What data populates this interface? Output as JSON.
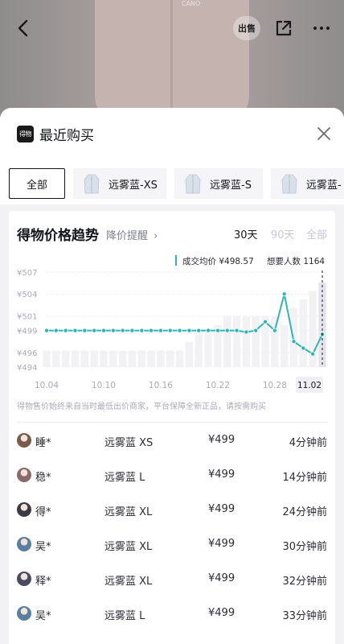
{
  "colors": {
    "teal": "#2fb5b7",
    "text": "#14151a",
    "muted": "#aaaabb",
    "bar": "#f0f0f3"
  },
  "top_bar": {
    "back_icon": "chevron-left-icon",
    "sell_label": "出售",
    "share_icon": "share-icon",
    "more_icon": "more-icon",
    "product_logo_text": "CANO"
  },
  "sheet": {
    "logo_text": "得物",
    "title": "最近购买",
    "close_icon": "close-icon"
  },
  "chips": [
    {
      "label": "全部",
      "active": true
    },
    {
      "label": "远雾蓝-XS",
      "active": false
    },
    {
      "label": "远雾蓝-S",
      "active": false
    },
    {
      "label": "远雾蓝-",
      "active": false
    }
  ],
  "trend": {
    "title": "得物价格趋势",
    "alert_label": "降价提醒",
    "ranges": [
      "30天",
      "90天",
      "全部"
    ],
    "avg_label": "成交均价 ¥498.57",
    "want_label": "想要人数 1164",
    "disclaimer": "得物售价始终来自当时最低出价商家，平台保障全新正品，请按需购买"
  },
  "chart_data": {
    "type": "line",
    "y_ticks": [
      "¥507",
      "¥504",
      "¥501",
      "¥499",
      "¥496",
      "¥494"
    ],
    "ylim": [
      494,
      507
    ],
    "x_ticks": [
      "10.04",
      "10.10",
      "10.16",
      "10.22",
      "10.28"
    ],
    "current_label": "11.02",
    "x": [
      "10.04",
      "10.05",
      "10.06",
      "10.07",
      "10.08",
      "10.09",
      "10.10",
      "10.11",
      "10.12",
      "10.13",
      "10.14",
      "10.15",
      "10.16",
      "10.17",
      "10.18",
      "10.19",
      "10.20",
      "10.21",
      "10.22",
      "10.23",
      "10.24",
      "10.25",
      "10.26",
      "10.27",
      "10.28",
      "10.29",
      "10.30",
      "10.31",
      "11.01",
      "11.02"
    ],
    "series": [
      {
        "values": [
          499,
          499,
          499,
          499,
          499,
          499,
          499,
          499,
          499,
          499,
          499,
          499,
          499,
          499,
          499,
          499,
          499,
          499,
          499,
          499,
          499,
          498.8,
          499,
          500.2,
          499,
          504,
          497.5,
          496.6,
          495.8,
          498.5
        ]
      }
    ],
    "volume": [
      1,
      1,
      1,
      1,
      1,
      1,
      1,
      1,
      1,
      1,
      1,
      1,
      1,
      1,
      1,
      2,
      3,
      3,
      4,
      5,
      5,
      5,
      5,
      5,
      5,
      4,
      6,
      7,
      8,
      9
    ]
  },
  "purchases": [
    {
      "user": "睡*",
      "spec": "远雾蓝 XS",
      "price": "¥499",
      "time": "4分钟前",
      "avatar": "#7a5a4a"
    },
    {
      "user": "稳*",
      "spec": "远雾蓝 L",
      "price": "¥499",
      "time": "14分钟前",
      "avatar": "#8a6a6a"
    },
    {
      "user": "得*",
      "spec": "远雾蓝 XL",
      "price": "¥499",
      "time": "24分钟前",
      "avatar": "#3b3b44"
    },
    {
      "user": "吴*",
      "spec": "远雾蓝 XL",
      "price": "¥499",
      "time": "30分钟前",
      "avatar": "#5a7fa0"
    },
    {
      "user": "释*",
      "spec": "远雾蓝 XL",
      "price": "¥499",
      "time": "32分钟前",
      "avatar": "#4a4a60"
    },
    {
      "user": "吴*",
      "spec": "远雾蓝 L",
      "price": "¥499",
      "time": "33分钟前",
      "avatar": "#5a7fa0"
    }
  ]
}
